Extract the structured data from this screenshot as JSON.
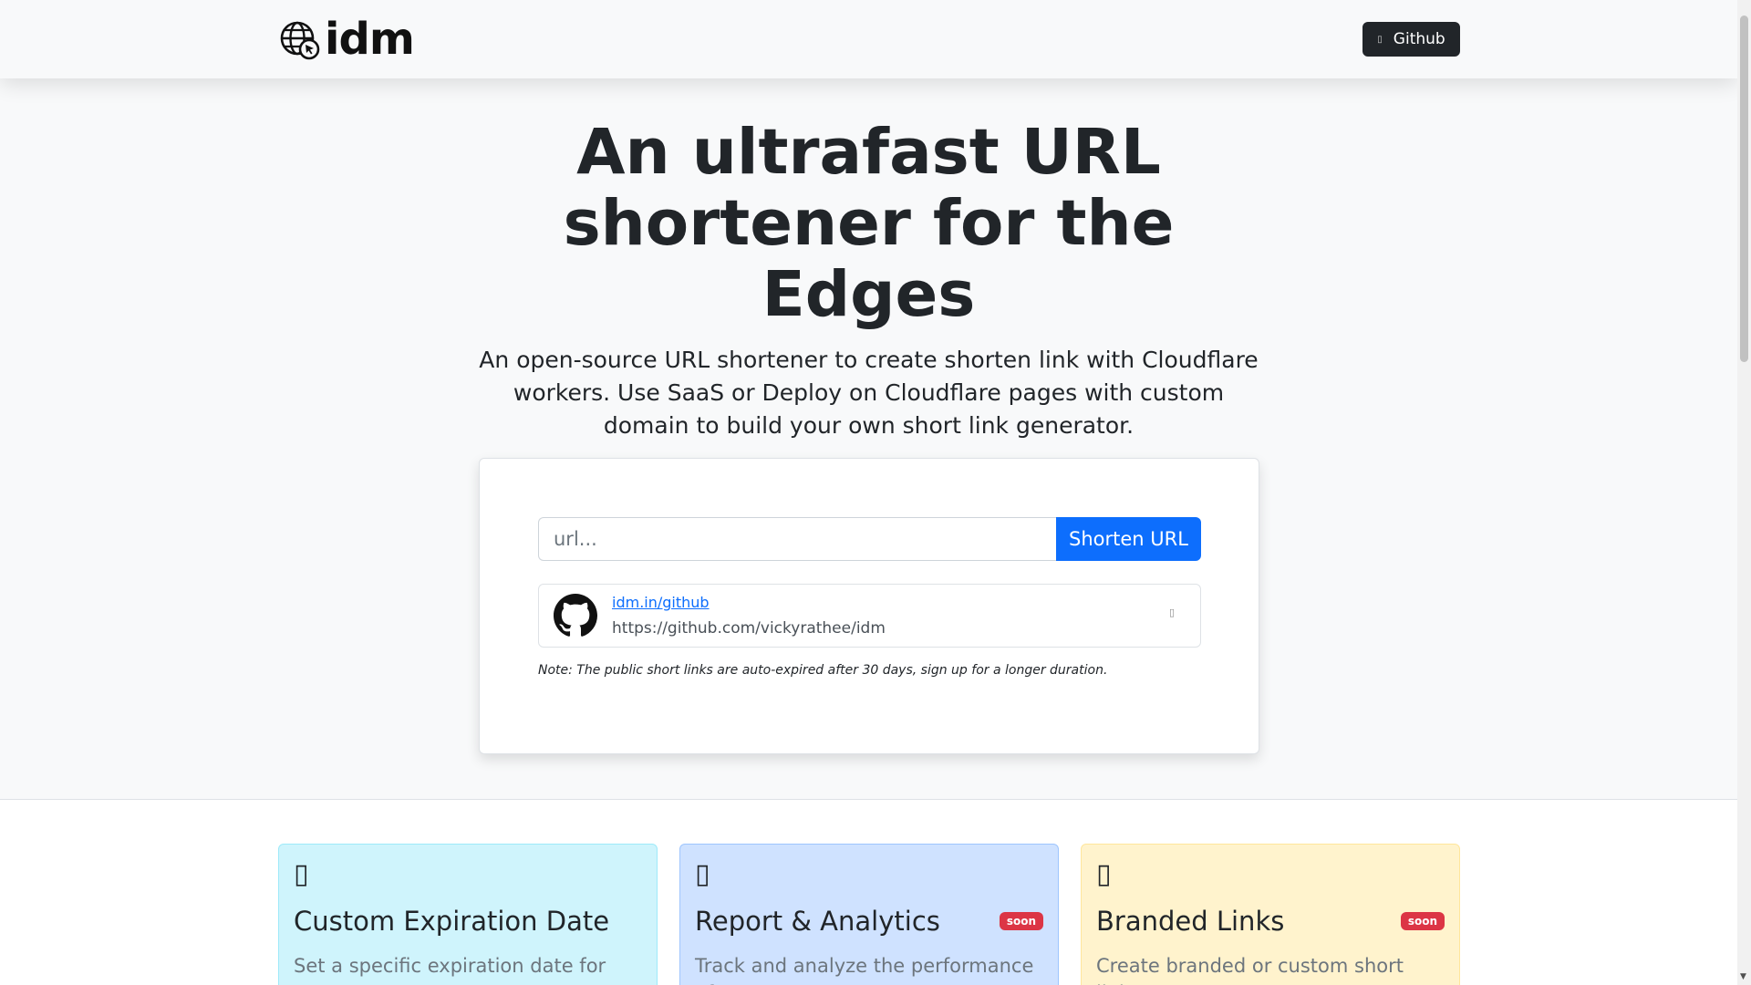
{
  "navbar": {
    "brand": "idm",
    "github_label": "Github",
    "github_icon": "github-icon"
  },
  "hero": {
    "title": "An ultrafast URL shortener for the Edges",
    "subtitle": "An open-source URL shortener to create shorten link with Cloudflare workers. Use SaaS or Deploy on Cloudflare pages with custom domain to build your own short link generator."
  },
  "shortener": {
    "placeholder": "url...",
    "button_label": "Shorten URL",
    "links": [
      {
        "short": "idm.in/github",
        "long": "https://github.com/vickyrathee/idm",
        "icon": "github-icon"
      }
    ],
    "note": "Note: The public short links are auto-expired after 30 days, sign up for a longer duration."
  },
  "features": [
    {
      "icon": "calendar-icon",
      "title": "Custom Expiration Date",
      "badge": "",
      "description": "Set a specific expiration date for your"
    },
    {
      "icon": "chart-icon",
      "title": "Report & Analytics",
      "badge": "soon",
      "description": "Track and analyze the performance of"
    },
    {
      "icon": "link-icon",
      "title": "Branded Links",
      "badge": "soon",
      "description": "Create branded or custom short links"
    }
  ],
  "colors": {
    "primary": "#0d6efd",
    "dark": "#212529",
    "badge": "#dc3545",
    "info_bg": "#cff4fc",
    "primary_bg": "#cfe2ff",
    "warning_bg": "#fff3cd"
  }
}
